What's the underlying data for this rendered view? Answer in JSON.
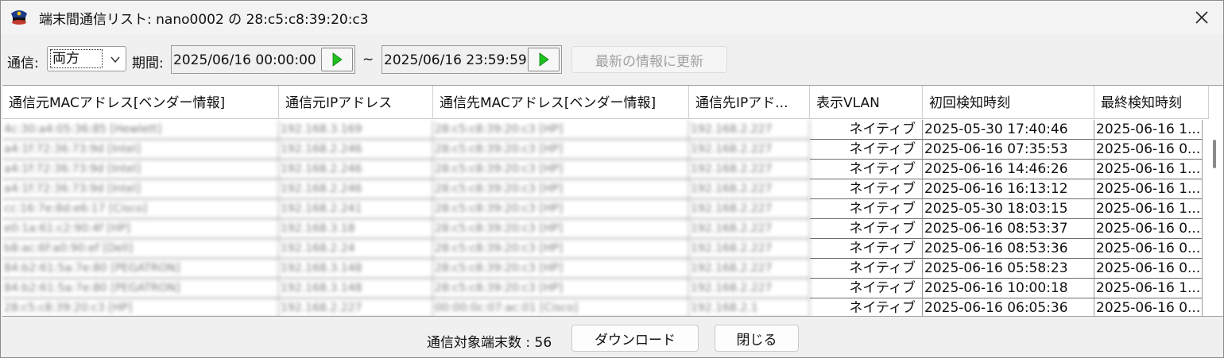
{
  "window": {
    "title": "端末間通信リスト: nano0002 の 28:c5:c8:39:20:c3",
    "icon": "police-cap-icon",
    "close_icon": "close-icon"
  },
  "toolbar": {
    "direction_label": "通信:",
    "direction_value": "両方",
    "period_label": "期間:",
    "start_datetime": "2025/06/16 00:00:00",
    "tilde": "~",
    "end_datetime": "2025/06/16 23:59:59",
    "refresh_label": "最新の情報に更新",
    "accent_play": "#1ec21e"
  },
  "table": {
    "columns": [
      "通信元MACアドレス[ベンダー情報]",
      "通信元IPアドレス",
      "通信先MACアドレス[ベンダー情報]",
      "通信先IPアド...",
      "表示VLAN",
      "初回検知時刻",
      "最終検知時刻"
    ],
    "rows": [
      {
        "src_mac": "4c:30:a4:05:36:85 [Hewlett]",
        "src_ip": "192.168.3.169",
        "dst_mac": "28:c5:c8:39:20:c3 [HP]",
        "dst_ip": "192.168.2.227",
        "vlan": "ネイティブ",
        "first": "2025-05-30 17:40:46",
        "last": "2025-06-16 1..."
      },
      {
        "src_mac": "a4:1f:72:36:73:9d [Intel]",
        "src_ip": "192.168.2.246",
        "dst_mac": "28:c5:c8:39:20:c3 [HP]",
        "dst_ip": "192.168.2.227",
        "vlan": "ネイティブ",
        "first": "2025-06-16 07:35:53",
        "last": "2025-06-16 0..."
      },
      {
        "src_mac": "a4:1f:72:36:73:9d [Intel]",
        "src_ip": "192.168.2.246",
        "dst_mac": "28:c5:c8:39:20:c3 [HP]",
        "dst_ip": "192.168.2.227",
        "vlan": "ネイティブ",
        "first": "2025-06-16 14:46:26",
        "last": "2025-06-16 1..."
      },
      {
        "src_mac": "a4:1f:72:36:73:9d [Intel]",
        "src_ip": "192.168.2.246",
        "dst_mac": "28:c5:c8:39:20:c3 [HP]",
        "dst_ip": "192.168.2.227",
        "vlan": "ネイティブ",
        "first": "2025-06-16 16:13:12",
        "last": "2025-06-16 1..."
      },
      {
        "src_mac": "cc:16:7e:8d:e6:17 [Cisco]",
        "src_ip": "192.168.2.241",
        "dst_mac": "28:c5:c8:39:20:c3 [HP]",
        "dst_ip": "192.168.2.227",
        "vlan": "ネイティブ",
        "first": "2025-05-30 18:03:15",
        "last": "2025-06-16 1..."
      },
      {
        "src_mac": "e0:1a:61:c2:90:4f [HP]",
        "src_ip": "192.168.3.18",
        "dst_mac": "28:c5:c8:39:20:c3 [HP]",
        "dst_ip": "192.168.2.227",
        "vlan": "ネイティブ",
        "first": "2025-06-16 08:53:37",
        "last": "2025-06-16 0..."
      },
      {
        "src_mac": "b8:ac:6f:a0:90:ef [Dell]",
        "src_ip": "192.168.2.24",
        "dst_mac": "28:c5:c8:39:20:c3 [HP]",
        "dst_ip": "192.168.2.227",
        "vlan": "ネイティブ",
        "first": "2025-06-16 08:53:36",
        "last": "2025-06-16 0..."
      },
      {
        "src_mac": "84:b2:61:5a:7e:80 [PEGATRON]",
        "src_ip": "192.168.3.148",
        "dst_mac": "28:c5:c8:39:20:c3 [HP]",
        "dst_ip": "192.168.2.227",
        "vlan": "ネイティブ",
        "first": "2025-06-16 05:58:23",
        "last": "2025-06-16 0..."
      },
      {
        "src_mac": "84:b2:61:5a:7e:80 [PEGATRON]",
        "src_ip": "192.168.3.148",
        "dst_mac": "28:c5:c8:39:20:c3 [HP]",
        "dst_ip": "192.168.2.227",
        "vlan": "ネイティブ",
        "first": "2025-06-16 10:00:18",
        "last": "2025-06-16 1..."
      },
      {
        "src_mac": "28:c5:c8:39:20:c3 [HP]",
        "src_ip": "192.168.2.227",
        "dst_mac": "00:00:0c:07:ac:01 [Cisco]",
        "dst_ip": "192.168.2.1",
        "vlan": "ネイティブ",
        "first": "2025-06-16 06:05:36",
        "last": "2025-06-16 0..."
      }
    ]
  },
  "footer": {
    "count_label": "通信対象端末数 : 56",
    "download_label": "ダウンロード",
    "close_label": "閉じる"
  }
}
